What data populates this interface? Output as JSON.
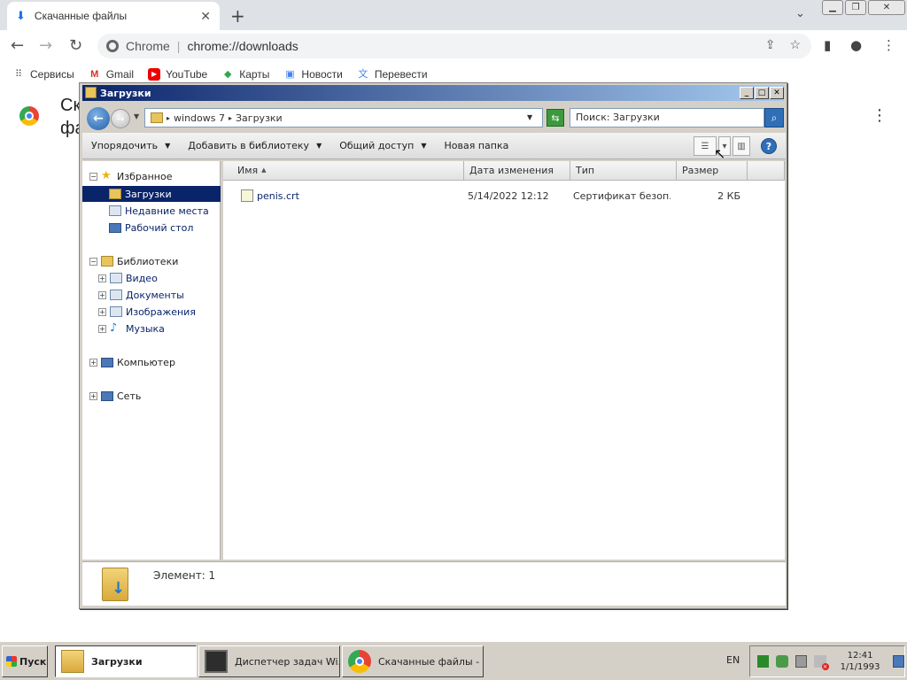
{
  "chrome": {
    "tab_title": "Скачанные файлы",
    "tab_close": "✕",
    "new_tab": "+",
    "site_name": "Chrome",
    "url_separator": "|",
    "url": "chrome://downloads",
    "bookmarks": [
      {
        "label": "Сервисы",
        "icon": "apps-grid-icon"
      },
      {
        "label": "Gmail",
        "icon": "gmail-icon"
      },
      {
        "label": "YouTube",
        "icon": "youtube-icon"
      },
      {
        "label": "Карты",
        "icon": "maps-icon"
      },
      {
        "label": "Новости",
        "icon": "news-icon"
      },
      {
        "label": "Перевести",
        "icon": "translate-icon"
      }
    ],
    "page_heading": "Скачанные файлы"
  },
  "explorer": {
    "title": "Загрузки",
    "address_crumbs": [
      "windows 7",
      "Загрузки"
    ],
    "search_placeholder": "Поиск: Загрузки",
    "commands": [
      {
        "label": "Упорядочить",
        "has_caret": true
      },
      {
        "label": "Добавить в библиотеку",
        "has_caret": true
      },
      {
        "label": "Общий доступ",
        "has_caret": true
      },
      {
        "label": "Новая папка",
        "has_caret": false
      }
    ],
    "nav": {
      "favorites": {
        "label": "Избранное",
        "expander": "−"
      },
      "favorites_items": [
        {
          "label": "Загрузки",
          "selected": true
        },
        {
          "label": "Недавние места",
          "selected": false
        },
        {
          "label": "Рабочий стол",
          "selected": false
        }
      ],
      "libraries": {
        "label": "Библиотеки",
        "expander": "−"
      },
      "libraries_items": [
        {
          "label": "Видео",
          "expander": "+"
        },
        {
          "label": "Документы",
          "expander": "+"
        },
        {
          "label": "Изображения",
          "expander": "+"
        },
        {
          "label": "Музыка",
          "expander": "+"
        }
      ],
      "computer": {
        "label": "Компьютер",
        "expander": "+"
      },
      "network": {
        "label": "Сеть",
        "expander": "+"
      }
    },
    "columns": [
      "Имя",
      "Дата изменения",
      "Тип",
      "Размер"
    ],
    "files": [
      {
        "name": "penis.crt",
        "date": "5/14/2022 12:12",
        "type": "Сертификат безоп...",
        "size": "2 КБ"
      }
    ],
    "status": "Элемент: 1"
  },
  "taskbar": {
    "start_label": "Пуск",
    "tasks": [
      {
        "label": "Загрузки",
        "active": true
      },
      {
        "label": "Диспетчер задач Wi...",
        "active": false
      },
      {
        "label": "Скачанные файлы - ...",
        "active": false
      }
    ],
    "language": "EN",
    "time": "12:41",
    "date": "1/1/1993"
  }
}
